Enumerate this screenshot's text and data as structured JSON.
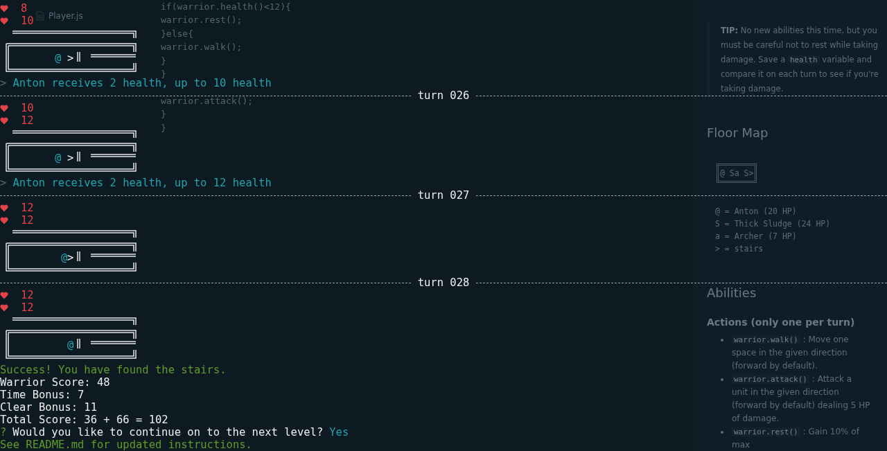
{
  "editor": {
    "file": "Player.js",
    "code": [
      {
        "text": "if(warrior.health()<12){"
      },
      {
        "text": "warrior.rest();"
      },
      {
        "text": "}else{"
      },
      {
        "text": "warrior.walk();"
      },
      {
        "text": "}"
      },
      {
        "text": "}"
      },
      {
        "text": "warrior.attack();",
        "blank_before": true
      },
      {
        "text": "}"
      },
      {
        "text": "}"
      }
    ]
  },
  "readme": {
    "tip": [
      {
        "kind": "text",
        "text": "**TIP:** No new abilities this time, but you must be careful not to rest while taking damage. Save a "
      },
      {
        "kind": "code",
        "text": "health"
      },
      {
        "kind": "text",
        "text": " variable and compare it on each turn to see if you're taking damage."
      }
    ],
    "floor_map_title": "Floor Map",
    "floor_map": "@ Sa S>",
    "legend": [
      "@ = Anton (20 HP)",
      "S = Thick Sludge (24 HP)",
      "a = Archer (7 HP)",
      "> = stairs"
    ],
    "abilities_title": "Abilities",
    "actions_title": "Actions (only one per turn)",
    "actions": [
      {
        "code": "warrior.walk()",
        "text": ": Move one space in the given direction (forward by default)."
      },
      {
        "code": "warrior.attack()",
        "text": ": Attack a unit in the given direction (forward by default) dealing 5 HP of damage."
      },
      {
        "code": "warrior.rest()",
        "text": ": Gain 10% of max"
      }
    ]
  },
  "terminal": [
    {
      "kind": "health",
      "value": "8"
    },
    {
      "kind": "health",
      "value": "10"
    },
    {
      "kind": "map",
      "cells": [
        {
          "kind": "floor"
        },
        {
          "kind": "floor"
        },
        {
          "kind": "floor"
        },
        {
          "kind": "floor"
        },
        {
          "kind": "floor"
        },
        {
          "kind": "floor"
        },
        {
          "kind": "floor"
        },
        {
          "kind": "warrior",
          "symbol": "@"
        },
        {
          "kind": "floor"
        },
        {
          "kind": "stairs",
          "symbol": ">"
        }
      ]
    },
    {
      "kind": "message",
      "prompt": ">",
      "text": "Anton receives 2 health, up to 10 health"
    },
    {
      "kind": "turn",
      "label": "turn 026"
    },
    {
      "kind": "health",
      "value": "10"
    },
    {
      "kind": "health",
      "value": "12"
    },
    {
      "kind": "map",
      "cells": [
        {
          "kind": "floor"
        },
        {
          "kind": "floor"
        },
        {
          "kind": "floor"
        },
        {
          "kind": "floor"
        },
        {
          "kind": "floor"
        },
        {
          "kind": "floor"
        },
        {
          "kind": "floor"
        },
        {
          "kind": "warrior",
          "symbol": "@"
        },
        {
          "kind": "floor"
        },
        {
          "kind": "stairs",
          "symbol": ">"
        }
      ]
    },
    {
      "kind": "message",
      "prompt": ">",
      "text": "Anton receives 2 health, up to 12 health"
    },
    {
      "kind": "turn",
      "label": "turn 027"
    },
    {
      "kind": "health",
      "value": "12"
    },
    {
      "kind": "health",
      "value": "12"
    },
    {
      "kind": "map",
      "cells": [
        {
          "kind": "floor"
        },
        {
          "kind": "floor"
        },
        {
          "kind": "floor"
        },
        {
          "kind": "floor"
        },
        {
          "kind": "floor"
        },
        {
          "kind": "floor"
        },
        {
          "kind": "floor"
        },
        {
          "kind": "floor"
        },
        {
          "kind": "warrior",
          "symbol": "@"
        },
        {
          "kind": "stairs",
          "symbol": ">"
        }
      ]
    },
    {
      "kind": "turn",
      "label": "turn 028"
    },
    {
      "kind": "health",
      "value": "12"
    },
    {
      "kind": "health",
      "value": "12"
    },
    {
      "kind": "map",
      "cells": [
        {
          "kind": "floor"
        },
        {
          "kind": "floor"
        },
        {
          "kind": "floor"
        },
        {
          "kind": "floor"
        },
        {
          "kind": "floor"
        },
        {
          "kind": "floor"
        },
        {
          "kind": "floor"
        },
        {
          "kind": "floor"
        },
        {
          "kind": "floor"
        },
        {
          "kind": "warrior",
          "symbol": "@"
        }
      ]
    },
    {
      "kind": "success",
      "text": "Success! You have found the stairs."
    },
    {
      "kind": "score",
      "text": "Warrior Score: 48"
    },
    {
      "kind": "score",
      "text": "Time Bonus: 7"
    },
    {
      "kind": "score",
      "text": "Clear Bonus: 11"
    },
    {
      "kind": "score",
      "text": "Total Score: 36 + 66 = 102"
    },
    {
      "kind": "question",
      "mark": "?",
      "text": "Would you like to continue on to the next level?",
      "answer": "Yes"
    },
    {
      "kind": "note",
      "text": "See README.md for updated instructions."
    }
  ]
}
